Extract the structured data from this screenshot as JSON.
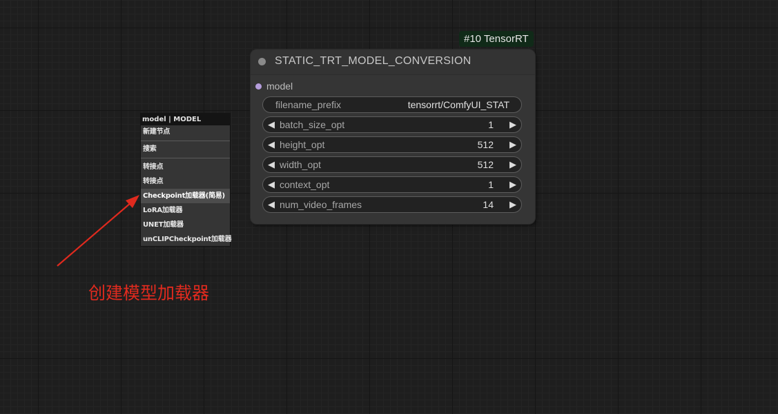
{
  "node": {
    "badge": "#10 TensorRT",
    "title": "STATIC_TRT_MODEL_CONVERSION",
    "input_slot": "model",
    "widgets": [
      {
        "label": "filename_prefix",
        "value": "tensorrt/ComfyUI_STAT",
        "kind": "text"
      },
      {
        "label": "batch_size_opt",
        "value": "1",
        "kind": "number"
      },
      {
        "label": "height_opt",
        "value": "512",
        "kind": "number"
      },
      {
        "label": "width_opt",
        "value": "512",
        "kind": "number"
      },
      {
        "label": "context_opt",
        "value": "1",
        "kind": "number"
      },
      {
        "label": "num_video_frames",
        "value": "14",
        "kind": "number"
      }
    ],
    "arrows": {
      "left": "◀",
      "right": "▶"
    }
  },
  "context_menu": {
    "title": "model | MODEL",
    "items": [
      {
        "label": "新建节点"
      },
      {
        "label": "搜索"
      },
      {
        "label": "转接点"
      },
      {
        "label": "转接点"
      },
      {
        "label": "Checkpoint加载器(简易)",
        "highlighted": true
      },
      {
        "label": "LoRA加载器"
      },
      {
        "label": "UNET加载器"
      },
      {
        "label": "unCLIPCheckpoint加载器"
      }
    ]
  },
  "annotation": {
    "text": "创建模型加载器",
    "color": "#e02a1e"
  },
  "colors": {
    "canvas_bg": "#1e1e1e",
    "node_bg": "#353535",
    "badge_bg": "#102a18",
    "input_slot_dot": "#b59ddc"
  }
}
